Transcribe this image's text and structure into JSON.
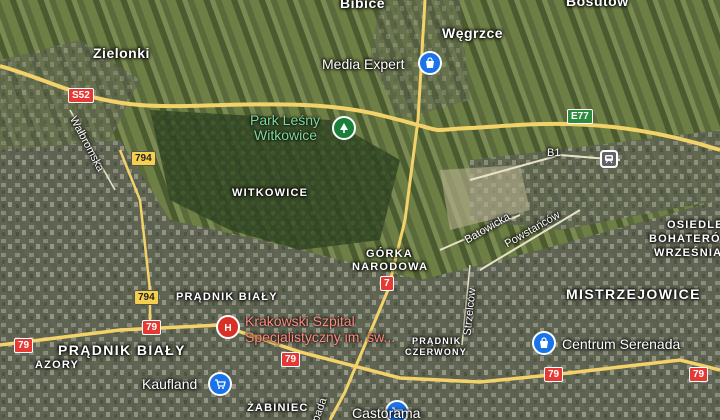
{
  "map": {
    "type": "satellite-hybrid",
    "colors": {
      "highway": "#f4d26a",
      "road": "#e8e3c8",
      "park_label": "#7fd99c",
      "hospital_label": "#ff8a80",
      "shop_pin": "#1a73e8",
      "park_pin": "#188038",
      "hospital_pin": "#d93025"
    }
  },
  "labels": {
    "bibice": "Bibice",
    "wegrzce": "Węgrzce",
    "bosutow": "Bosutów",
    "zielonki": "Zielonki",
    "witkowice": "WITKOWICE",
    "gorka1": "GÓRKA",
    "gorka2": "NARODOWA",
    "pradnik_bialy_upper": "PRĄDNIK BIAŁY",
    "pradnik_bialy_lower": "PRĄDNIK BIAŁY",
    "azory": "AZORY",
    "zabiniec": "ŻABINIEC",
    "mistrzejowice": "MISTRZEJOWICE",
    "osiedle": "OSIEDLE",
    "bohaterow": "BOHATERÓ",
    "wrzesnia": "WRZEŚNIA",
    "pradnik_czerwony1": "PRĄDNIK",
    "pradnik_czerwony2": "CZERWONY"
  },
  "streets": {
    "walbromska": "Wałbromska",
    "batowicka": "Batowicka",
    "powstancow": "Powstańców",
    "strzelcow": "Strzelców",
    "b1": "B1",
    "pada": "pada"
  },
  "pois": {
    "media_expert": "Media Expert",
    "park1": "Park Leśny",
    "park2": "Witkowice",
    "hospital1": "Krakowski Szpital",
    "hospital2": "Specjalistyczny im. św...",
    "kaufland": "Kaufland",
    "centrum_serenada": "Centrum Serenada",
    "castorama": "Castorama"
  },
  "shields": {
    "s52": "S52",
    "e77": "E77",
    "r794a": "794",
    "r794b": "794",
    "r7": "7",
    "r79a": "79",
    "r79b": "79",
    "r79c": "79",
    "r79d": "79",
    "r79e": "79"
  }
}
